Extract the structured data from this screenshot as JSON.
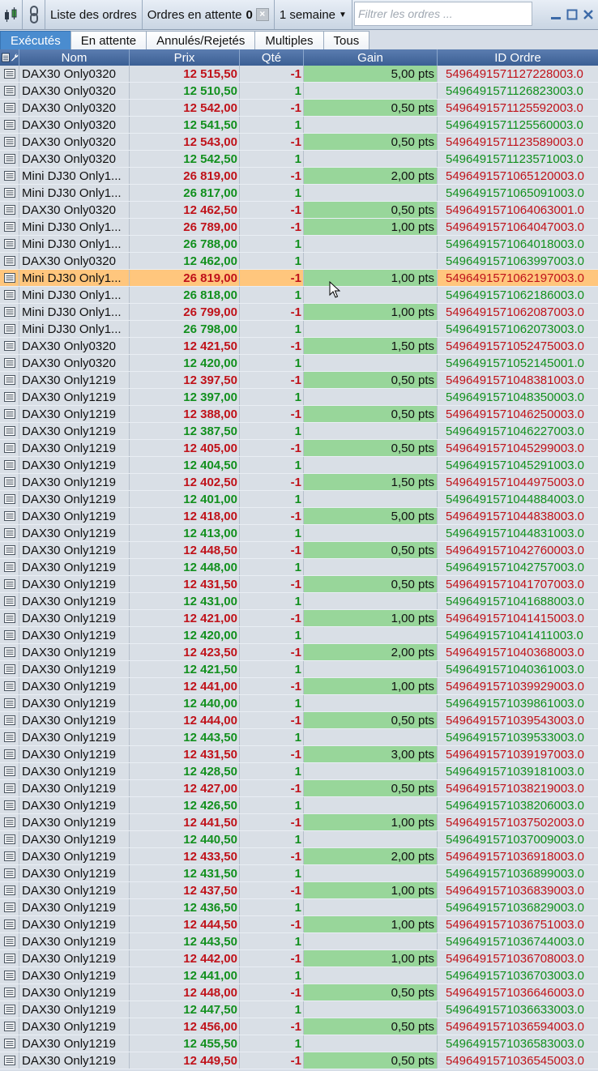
{
  "toolbar": {
    "orders_list_label": "Liste des ordres",
    "pending_label": "Ordres en attente",
    "pending_count": "0",
    "period_label": "1 semaine",
    "filter_placeholder": "Filtrer les ordres ..."
  },
  "tabs": [
    {
      "label": "Exécutés",
      "active": true
    },
    {
      "label": "En attente",
      "active": false
    },
    {
      "label": "Annulés/Rejetés",
      "active": false
    },
    {
      "label": "Multiples",
      "active": false
    },
    {
      "label": "Tous",
      "active": false
    }
  ],
  "columns": {
    "nom": "Nom",
    "prix": "Prix",
    "qte": "Qté",
    "gain": "Gain",
    "id": "ID Ordre"
  },
  "colors": {
    "sell": "#c0121a",
    "buy": "#12901e",
    "gain_bg": "#98d69a",
    "selected_bg": "#ffc67d",
    "active_tab": "#4a8ccf"
  },
  "selected_row": 12,
  "orders": [
    {
      "nom": "DAX30 Only0320",
      "prix": "12 515,50",
      "qte": "-1",
      "gain": "5,00 pts",
      "id": "5496491571127228003.0"
    },
    {
      "nom": "DAX30 Only0320",
      "prix": "12 510,50",
      "qte": "1",
      "gain": "",
      "id": "5496491571126823003.0"
    },
    {
      "nom": "DAX30 Only0320",
      "prix": "12 542,00",
      "qte": "-1",
      "gain": "0,50 pts",
      "id": "5496491571125592003.0"
    },
    {
      "nom": "DAX30 Only0320",
      "prix": "12 541,50",
      "qte": "1",
      "gain": "",
      "id": "5496491571125560003.0"
    },
    {
      "nom": "DAX30 Only0320",
      "prix": "12 543,00",
      "qte": "-1",
      "gain": "0,50 pts",
      "id": "5496491571123589003.0"
    },
    {
      "nom": "DAX30 Only0320",
      "prix": "12 542,50",
      "qte": "1",
      "gain": "",
      "id": "5496491571123571003.0"
    },
    {
      "nom": "Mini DJ30 Only1...",
      "prix": "26 819,00",
      "qte": "-1",
      "gain": "2,00 pts",
      "id": "5496491571065120003.0"
    },
    {
      "nom": "Mini DJ30 Only1...",
      "prix": "26 817,00",
      "qte": "1",
      "gain": "",
      "id": "5496491571065091003.0"
    },
    {
      "nom": "DAX30 Only0320",
      "prix": "12 462,50",
      "qte": "-1",
      "gain": "0,50 pts",
      "id": "5496491571064063001.0"
    },
    {
      "nom": "Mini DJ30 Only1...",
      "prix": "26 789,00",
      "qte": "-1",
      "gain": "1,00 pts",
      "id": "5496491571064047003.0"
    },
    {
      "nom": "Mini DJ30 Only1...",
      "prix": "26 788,00",
      "qte": "1",
      "gain": "",
      "id": "5496491571064018003.0"
    },
    {
      "nom": "DAX30 Only0320",
      "prix": "12 462,00",
      "qte": "1",
      "gain": "",
      "id": "5496491571063997003.0"
    },
    {
      "nom": "Mini DJ30 Only1...",
      "prix": "26 819,00",
      "qte": "-1",
      "gain": "1,00 pts",
      "id": "5496491571062197003.0"
    },
    {
      "nom": "Mini DJ30 Only1...",
      "prix": "26 818,00",
      "qte": "1",
      "gain": "",
      "id": "5496491571062186003.0"
    },
    {
      "nom": "Mini DJ30 Only1...",
      "prix": "26 799,00",
      "qte": "-1",
      "gain": "1,00 pts",
      "id": "5496491571062087003.0"
    },
    {
      "nom": "Mini DJ30 Only1...",
      "prix": "26 798,00",
      "qte": "1",
      "gain": "",
      "id": "5496491571062073003.0"
    },
    {
      "nom": "DAX30 Only0320",
      "prix": "12 421,50",
      "qte": "-1",
      "gain": "1,50 pts",
      "id": "5496491571052475003.0"
    },
    {
      "nom": "DAX30 Only0320",
      "prix": "12 420,00",
      "qte": "1",
      "gain": "",
      "id": "5496491571052145001.0"
    },
    {
      "nom": "DAX30 Only1219",
      "prix": "12 397,50",
      "qte": "-1",
      "gain": "0,50 pts",
      "id": "5496491571048381003.0"
    },
    {
      "nom": "DAX30 Only1219",
      "prix": "12 397,00",
      "qte": "1",
      "gain": "",
      "id": "5496491571048350003.0"
    },
    {
      "nom": "DAX30 Only1219",
      "prix": "12 388,00",
      "qte": "-1",
      "gain": "0,50 pts",
      "id": "5496491571046250003.0"
    },
    {
      "nom": "DAX30 Only1219",
      "prix": "12 387,50",
      "qte": "1",
      "gain": "",
      "id": "5496491571046227003.0"
    },
    {
      "nom": "DAX30 Only1219",
      "prix": "12 405,00",
      "qte": "-1",
      "gain": "0,50 pts",
      "id": "5496491571045299003.0"
    },
    {
      "nom": "DAX30 Only1219",
      "prix": "12 404,50",
      "qte": "1",
      "gain": "",
      "id": "5496491571045291003.0"
    },
    {
      "nom": "DAX30 Only1219",
      "prix": "12 402,50",
      "qte": "-1",
      "gain": "1,50 pts",
      "id": "5496491571044975003.0"
    },
    {
      "nom": "DAX30 Only1219",
      "prix": "12 401,00",
      "qte": "1",
      "gain": "",
      "id": "5496491571044884003.0"
    },
    {
      "nom": "DAX30 Only1219",
      "prix": "12 418,00",
      "qte": "-1",
      "gain": "5,00 pts",
      "id": "5496491571044838003.0"
    },
    {
      "nom": "DAX30 Only1219",
      "prix": "12 413,00",
      "qte": "1",
      "gain": "",
      "id": "5496491571044831003.0"
    },
    {
      "nom": "DAX30 Only1219",
      "prix": "12 448,50",
      "qte": "-1",
      "gain": "0,50 pts",
      "id": "5496491571042760003.0"
    },
    {
      "nom": "DAX30 Only1219",
      "prix": "12 448,00",
      "qte": "1",
      "gain": "",
      "id": "5496491571042757003.0"
    },
    {
      "nom": "DAX30 Only1219",
      "prix": "12 431,50",
      "qte": "-1",
      "gain": "0,50 pts",
      "id": "5496491571041707003.0"
    },
    {
      "nom": "DAX30 Only1219",
      "prix": "12 431,00",
      "qte": "1",
      "gain": "",
      "id": "5496491571041688003.0"
    },
    {
      "nom": "DAX30 Only1219",
      "prix": "12 421,00",
      "qte": "-1",
      "gain": "1,00 pts",
      "id": "5496491571041415003.0"
    },
    {
      "nom": "DAX30 Only1219",
      "prix": "12 420,00",
      "qte": "1",
      "gain": "",
      "id": "5496491571041411003.0"
    },
    {
      "nom": "DAX30 Only1219",
      "prix": "12 423,50",
      "qte": "-1",
      "gain": "2,00 pts",
      "id": "5496491571040368003.0"
    },
    {
      "nom": "DAX30 Only1219",
      "prix": "12 421,50",
      "qte": "1",
      "gain": "",
      "id": "5496491571040361003.0"
    },
    {
      "nom": "DAX30 Only1219",
      "prix": "12 441,00",
      "qte": "-1",
      "gain": "1,00 pts",
      "id": "5496491571039929003.0"
    },
    {
      "nom": "DAX30 Only1219",
      "prix": "12 440,00",
      "qte": "1",
      "gain": "",
      "id": "5496491571039861003.0"
    },
    {
      "nom": "DAX30 Only1219",
      "prix": "12 444,00",
      "qte": "-1",
      "gain": "0,50 pts",
      "id": "5496491571039543003.0"
    },
    {
      "nom": "DAX30 Only1219",
      "prix": "12 443,50",
      "qte": "1",
      "gain": "",
      "id": "5496491571039533003.0"
    },
    {
      "nom": "DAX30 Only1219",
      "prix": "12 431,50",
      "qte": "-1",
      "gain": "3,00 pts",
      "id": "5496491571039197003.0"
    },
    {
      "nom": "DAX30 Only1219",
      "prix": "12 428,50",
      "qte": "1",
      "gain": "",
      "id": "5496491571039181003.0"
    },
    {
      "nom": "DAX30 Only1219",
      "prix": "12 427,00",
      "qte": "-1",
      "gain": "0,50 pts",
      "id": "5496491571038219003.0"
    },
    {
      "nom": "DAX30 Only1219",
      "prix": "12 426,50",
      "qte": "1",
      "gain": "",
      "id": "5496491571038206003.0"
    },
    {
      "nom": "DAX30 Only1219",
      "prix": "12 441,50",
      "qte": "-1",
      "gain": "1,00 pts",
      "id": "5496491571037502003.0"
    },
    {
      "nom": "DAX30 Only1219",
      "prix": "12 440,50",
      "qte": "1",
      "gain": "",
      "id": "5496491571037009003.0"
    },
    {
      "nom": "DAX30 Only1219",
      "prix": "12 433,50",
      "qte": "-1",
      "gain": "2,00 pts",
      "id": "5496491571036918003.0"
    },
    {
      "nom": "DAX30 Only1219",
      "prix": "12 431,50",
      "qte": "1",
      "gain": "",
      "id": "5496491571036899003.0"
    },
    {
      "nom": "DAX30 Only1219",
      "prix": "12 437,50",
      "qte": "-1",
      "gain": "1,00 pts",
      "id": "5496491571036839003.0"
    },
    {
      "nom": "DAX30 Only1219",
      "prix": "12 436,50",
      "qte": "1",
      "gain": "",
      "id": "5496491571036829003.0"
    },
    {
      "nom": "DAX30 Only1219",
      "prix": "12 444,50",
      "qte": "-1",
      "gain": "1,00 pts",
      "id": "5496491571036751003.0"
    },
    {
      "nom": "DAX30 Only1219",
      "prix": "12 443,50",
      "qte": "1",
      "gain": "",
      "id": "5496491571036744003.0"
    },
    {
      "nom": "DAX30 Only1219",
      "prix": "12 442,00",
      "qte": "-1",
      "gain": "1,00 pts",
      "id": "5496491571036708003.0"
    },
    {
      "nom": "DAX30 Only1219",
      "prix": "12 441,00",
      "qte": "1",
      "gain": "",
      "id": "5496491571036703003.0"
    },
    {
      "nom": "DAX30 Only1219",
      "prix": "12 448,00",
      "qte": "-1",
      "gain": "0,50 pts",
      "id": "5496491571036646003.0"
    },
    {
      "nom": "DAX30 Only1219",
      "prix": "12 447,50",
      "qte": "1",
      "gain": "",
      "id": "5496491571036633003.0"
    },
    {
      "nom": "DAX30 Only1219",
      "prix": "12 456,00",
      "qte": "-1",
      "gain": "0,50 pts",
      "id": "5496491571036594003.0"
    },
    {
      "nom": "DAX30 Only1219",
      "prix": "12 455,50",
      "qte": "1",
      "gain": "",
      "id": "5496491571036583003.0"
    },
    {
      "nom": "DAX30 Only1219",
      "prix": "12 449,50",
      "qte": "-1",
      "gain": "0,50 pts",
      "id": "5496491571036545003.0"
    }
  ]
}
